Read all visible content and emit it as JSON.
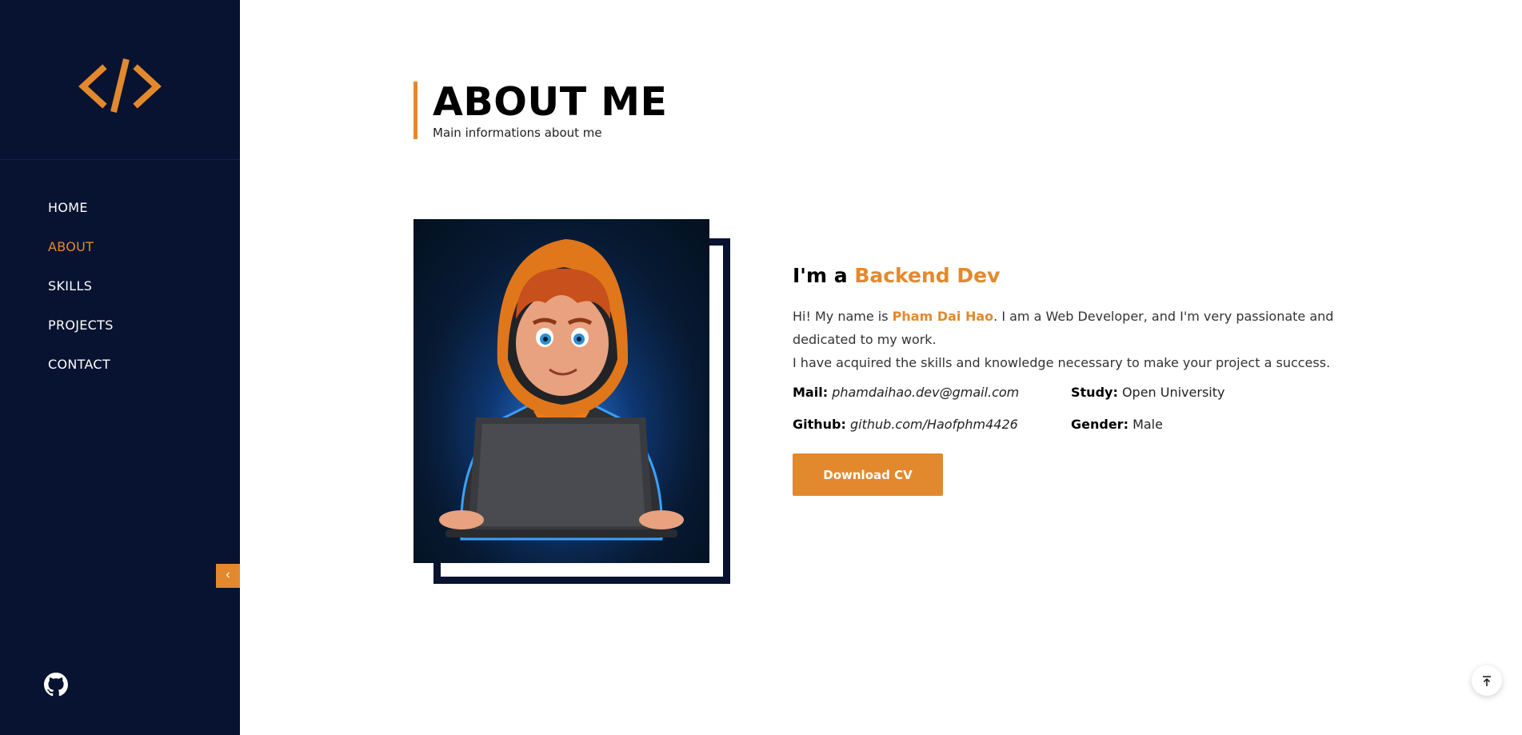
{
  "colors": {
    "sidebar": "#071330",
    "accent": "#e3892d",
    "text": "#000000"
  },
  "sidebar": {
    "logo_icon": "code-brackets-icon",
    "nav": [
      {
        "label": "HOME",
        "active": false
      },
      {
        "label": "ABOUT",
        "active": true
      },
      {
        "label": "SKILLS",
        "active": false
      },
      {
        "label": "PROJECTS",
        "active": false
      },
      {
        "label": "CONTACT",
        "active": false
      }
    ],
    "collapse_label": "‹",
    "social_icon": "github-icon"
  },
  "about": {
    "title": "ABOUT ME",
    "subtitle": "Main informations about me",
    "im_a": "I'm a",
    "role": "Backend Dev",
    "bio_1_pre": "Hi! My name is",
    "bio_name": "Pham Dai Hao",
    "bio_1_post": ". I am a Web Developer, and I'm very passionate and dedicated to my work.",
    "bio_2": "I have acquired the skills and knowledge necessary to make your project a success.",
    "details": [
      {
        "key": "Mail:",
        "value": "phamdaihao.dev@gmail.com"
      },
      {
        "key": "Study:",
        "value": "Open University"
      },
      {
        "key": "Github:",
        "value": "github.com/Haofphm4426"
      },
      {
        "key": "Gender:",
        "value": "Male"
      }
    ],
    "download_label": "Download CV"
  },
  "scroll_top_icon": "arrow-to-top-icon"
}
